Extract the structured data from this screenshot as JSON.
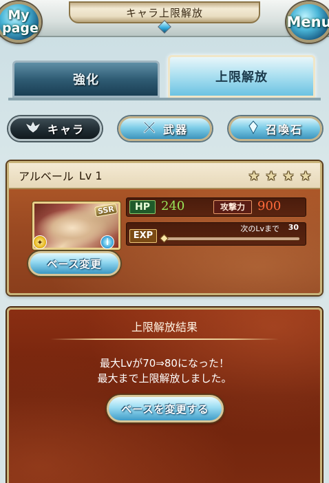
{
  "header": {
    "mypage_label": "My page",
    "title": "キャラ上限解放",
    "menu_label": "Menu"
  },
  "tabs": [
    {
      "label": "強化",
      "active": false
    },
    {
      "label": "上限解放",
      "active": true
    }
  ],
  "filters": [
    {
      "label": "キャラ",
      "icon": "character-emblem-icon",
      "active": true
    },
    {
      "label": "武器",
      "icon": "crossed-swords-icon",
      "active": false
    },
    {
      "label": "召喚石",
      "icon": "crystal-icon",
      "active": false
    }
  ],
  "character": {
    "name": "アルベール",
    "level": "Lv 1",
    "rarity_badge": "SSR",
    "stars_total": 4,
    "hp_label": "HP",
    "hp": "240",
    "atk_label": "攻撃力",
    "atk": "900",
    "exp_label": "EXP",
    "next_lv_label": "次のLvまで",
    "next_lv_value": "30",
    "exp_progress": 0,
    "base_change_label": "ベース変更"
  },
  "result": {
    "title": "上限解放結果",
    "line1": "最大Lvが70⇒80になった！",
    "line2": "最大まで上限解放しました。",
    "button_label": "ベースを変更する"
  },
  "colors": {
    "hp_value": "#9ae85a",
    "atk_value": "#ff6a3a",
    "panel_brown": "#9b4a22",
    "button_blue": "#8fd6ef"
  }
}
